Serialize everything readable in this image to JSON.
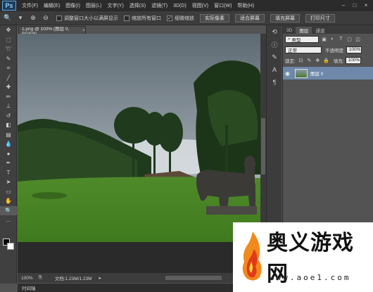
{
  "menubar": {
    "logo": "Ps",
    "items": [
      "文件(F)",
      "编辑(E)",
      "图像(I)",
      "图层(L)",
      "文字(Y)",
      "选择(S)",
      "滤镜(T)",
      "3D(D)",
      "视图(V)",
      "窗口(W)",
      "帮助(H)"
    ]
  },
  "options": {
    "check1": "调整窗口大小以满屏显示",
    "check2": "缩放所有窗口",
    "check3": "细微缩放",
    "btn_actual": "实际像素",
    "btn_fit": "适合屏幕",
    "btn_fill": "填充屏幕",
    "btn_print": "打印尺寸"
  },
  "document": {
    "tab_title": "1.png @ 100% (图层 0, RGB/8)",
    "zoom": "100%",
    "doc_info": "文档:1.23M/1.23M",
    "bottom_tab": "时间轴"
  },
  "layers_panel": {
    "tabs": [
      "3D",
      "图层",
      "通道"
    ],
    "filter_label": "类型",
    "blend_mode": "正常",
    "opacity_label": "不透明度:",
    "opacity_value": "100%",
    "lock_label": "锁定:",
    "fill_label": "填充:",
    "fill_value": "100%",
    "layer_name": "图层 0"
  },
  "watermark": {
    "title": "奥义游戏网",
    "url": "www.aoe1.com"
  }
}
